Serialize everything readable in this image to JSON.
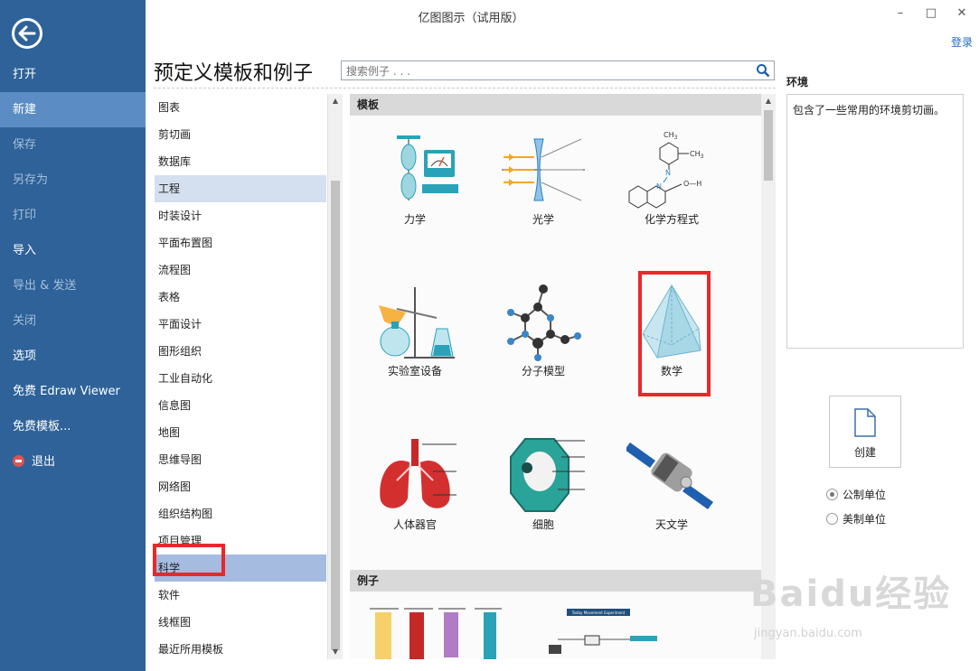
{
  "window": {
    "title": "亿图图示（试用版）",
    "login": "登录",
    "min_glyph": "–",
    "max_glyph": "□",
    "close_glyph": "✕"
  },
  "sidebar": {
    "items": [
      {
        "label": "打开",
        "state": "normal"
      },
      {
        "label": "新建",
        "state": "active"
      },
      {
        "label": "保存",
        "state": "disabled"
      },
      {
        "label": "另存为",
        "state": "disabled"
      },
      {
        "label": "打印",
        "state": "disabled"
      },
      {
        "label": "导入",
        "state": "normal"
      },
      {
        "label": "导出 & 发送",
        "state": "disabled"
      },
      {
        "label": "关闭",
        "state": "disabled"
      },
      {
        "label": "选项",
        "state": "normal"
      },
      {
        "label": "免费 Edraw Viewer",
        "state": "normal"
      },
      {
        "label": "免费模板...",
        "state": "normal"
      },
      {
        "label": "退出",
        "state": "normal"
      }
    ]
  },
  "main": {
    "title": "预定义模板和例子",
    "search_placeholder": "搜索例子 . . ."
  },
  "categories": [
    "图表",
    "剪切画",
    "数据库",
    "工程",
    "时装设计",
    "平面布置图",
    "流程图",
    "表格",
    "平面设计",
    "图形组织",
    "工业自动化",
    "信息图",
    "地图",
    "思维导图",
    "网络图",
    "组织结构图",
    "项目管理",
    "科学",
    "软件",
    "线框图",
    "最近所用模板"
  ],
  "panel": {
    "templates_header": "模板",
    "examples_header": "例子",
    "templates": [
      "力学",
      "光学",
      "化学方程式",
      "实验室设备",
      "分子模型",
      "数学",
      "人体器官",
      "细胞",
      "天文学"
    ],
    "chem_labels": {
      "ch3": "CH",
      "sub3": "3",
      "n": "N",
      "oh": "O—H"
    },
    "example_thumb_title": "Today Movement Experiment"
  },
  "right": {
    "env_title": "环境",
    "env_desc": "包含了一些常用的环境剪切画。",
    "create_label": "创建",
    "units": [
      {
        "label": "公制单位",
        "selected": true
      },
      {
        "label": "美制单位",
        "selected": false
      }
    ]
  },
  "watermark": {
    "text": "Baidu经验",
    "url": "jingyan.baidu.com"
  },
  "colors": {
    "sidebar": "#2e6299",
    "sidebar_active": "#5b8dc4",
    "highlight": "#e8282a",
    "category_selected": "#a5bbe0",
    "teal": "#2aa3b8"
  }
}
